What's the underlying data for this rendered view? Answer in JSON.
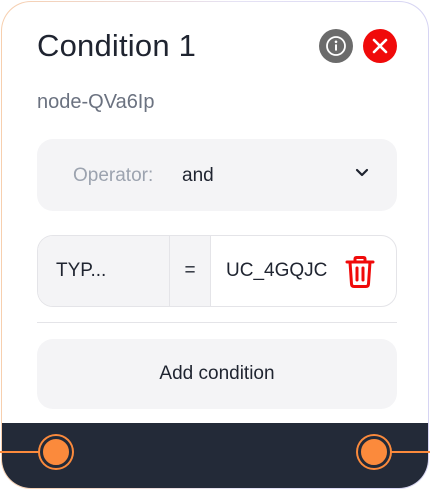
{
  "node": {
    "title": "Condition 1",
    "id": "node-QVa6Ip"
  },
  "operator": {
    "label": "Operator:",
    "value": "and"
  },
  "condition": {
    "field": "TYP...",
    "op": "=",
    "value": "UC_4GQJC"
  },
  "actions": {
    "add_condition": "Add condition"
  },
  "icons": {
    "info": "info-icon",
    "close": "close-icon",
    "chevron": "chevron-down-icon",
    "trash": "trash-icon"
  },
  "colors": {
    "accent": "#fb8a3c",
    "danger": "#f00a0a",
    "footer": "#232a38",
    "info": "#6b6b6b"
  }
}
